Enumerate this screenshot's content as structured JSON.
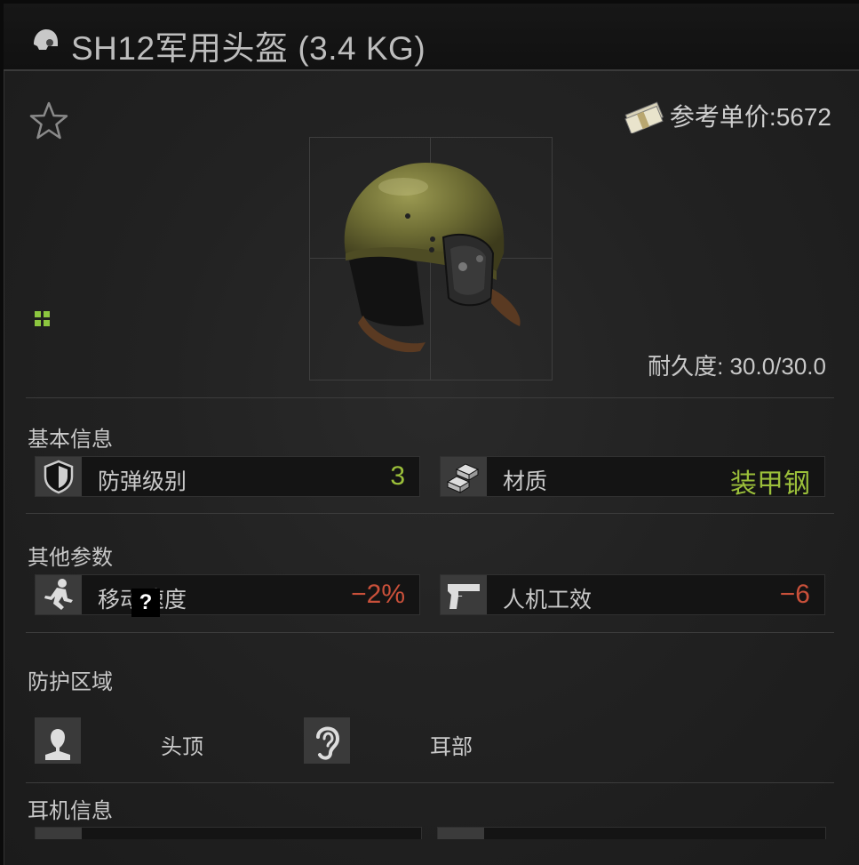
{
  "title": "SH12军用头盔 (3.4 KG)",
  "price": {
    "label": "参考单价:5672"
  },
  "durability": "耐久度: 30.0/30.0",
  "sections": {
    "basic": "基本信息",
    "other": "其他参数",
    "zones": "防护区域",
    "headset": "耳机信息"
  },
  "basic_stats": [
    {
      "label": "防弹级别",
      "value": "3",
      "icon": "shield-icon"
    },
    {
      "label": "材质",
      "value": "装甲钢",
      "icon": "ingots-icon"
    }
  ],
  "other_stats": [
    {
      "label": "移动速度",
      "value": "−2%",
      "icon": "running-man-icon"
    },
    {
      "label": "人机工效",
      "value": "−6",
      "icon": "pistol-icon"
    }
  ],
  "zones": [
    {
      "label": "头顶",
      "icon": "head-icon"
    },
    {
      "label": "耳部",
      "icon": "ear-icon"
    }
  ],
  "help_icon": "?",
  "colors": {
    "positive": "#9bbf3a",
    "negative": "#c9503a",
    "background": "#1e1e1e"
  }
}
